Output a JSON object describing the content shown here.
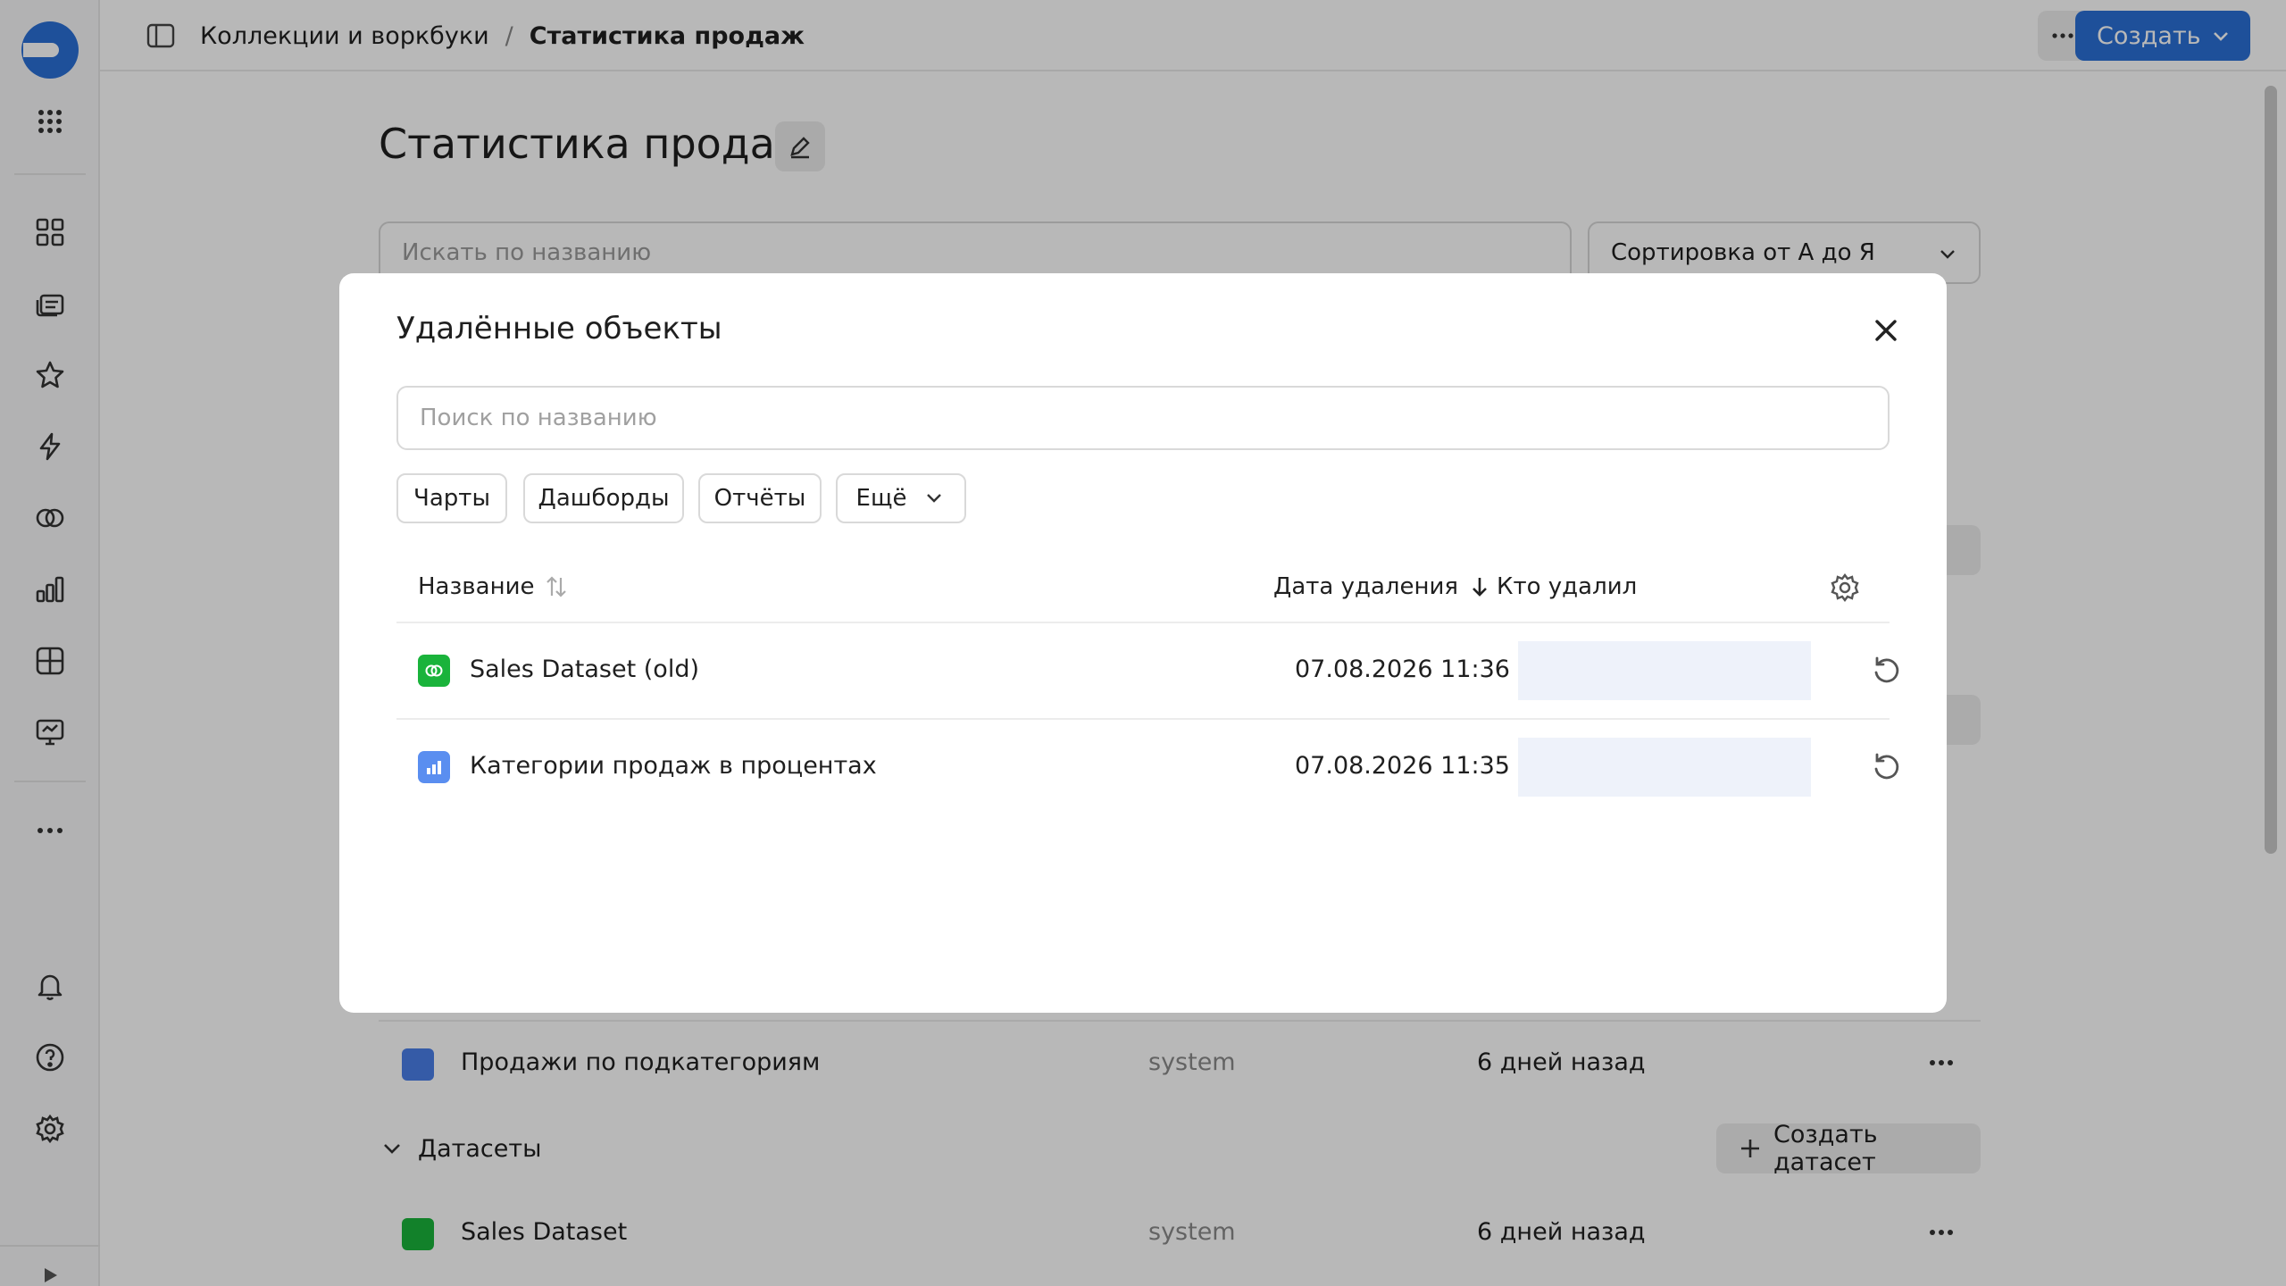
{
  "header": {
    "breadcrumb_parent": "Коллекции и воркбуки",
    "breadcrumb_sep": "/",
    "breadcrumb_current": "Статистика продаж",
    "create_label": "Создать"
  },
  "page": {
    "title": "Статистика продаж",
    "search_placeholder": "Искать по названию",
    "sort_label": "Сортировка от А до Я",
    "rows": [
      {
        "name": "Продажи по подкатегориям",
        "author": "system",
        "when": "6 дней назад"
      }
    ],
    "datasets_section": "Датасеты",
    "create_dataset_label": "Создать датасет",
    "dataset_rows": [
      {
        "name": "Sales Dataset",
        "author": "system",
        "when": "6 дней назад"
      }
    ]
  },
  "modal": {
    "title": "Удалённые объекты",
    "search_placeholder": "Поиск по названию",
    "filters": [
      "Чарты",
      "Дашборды",
      "Отчёты"
    ],
    "more_filter": "Ещё",
    "columns": {
      "name": "Название",
      "deleted_at": "Дата удаления",
      "deleted_by": "Кто удалил"
    },
    "items": [
      {
        "name": "Sales Dataset (old)",
        "deleted_at": "07.08.2026 11:36",
        "icon": "dataset-icon",
        "icon_color": "#1ab33b"
      },
      {
        "name": "Категории продаж в процентах",
        "deleted_at": "07.08.2026 11:35",
        "icon": "chart-icon",
        "icon_color": "#5a8ef0"
      }
    ]
  },
  "colors": {
    "accent": "#2a6fd6",
    "dataset": "#1ab33b",
    "chart": "#5a8ef0"
  }
}
